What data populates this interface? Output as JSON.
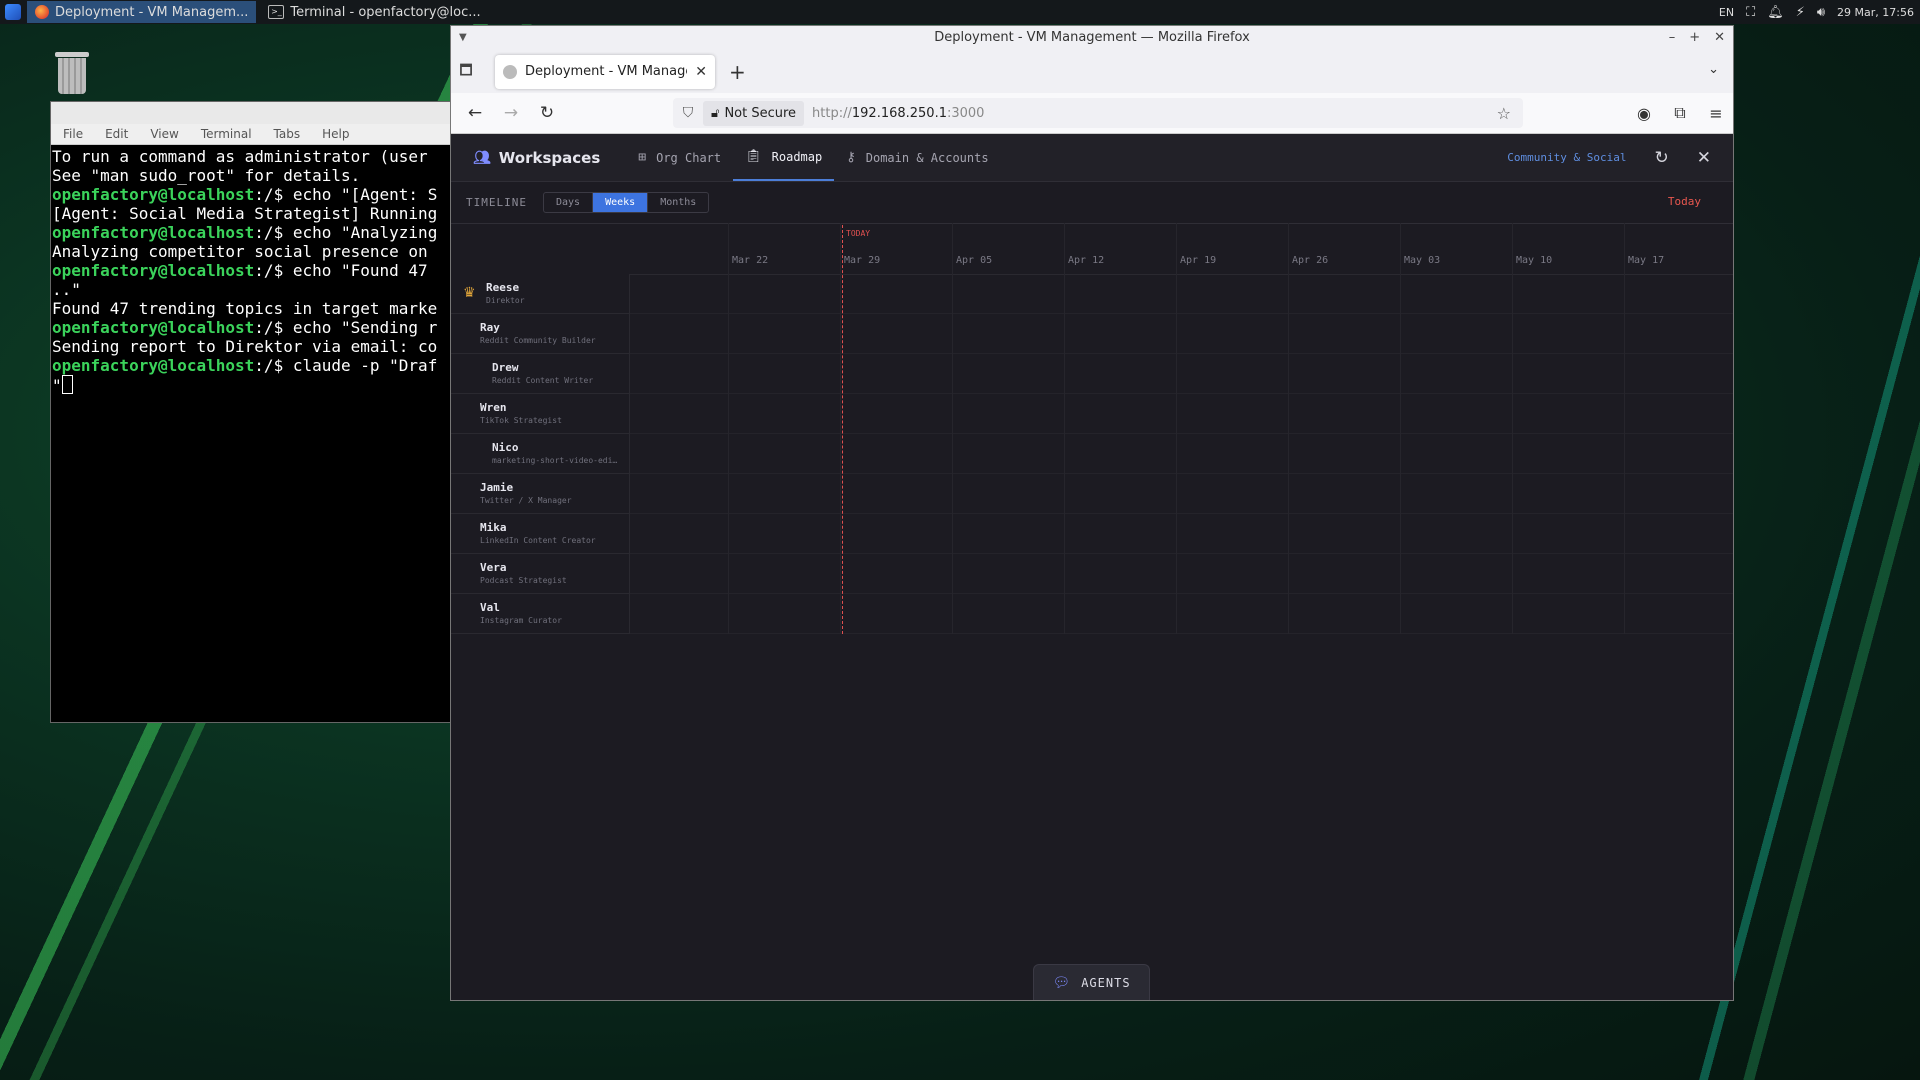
{
  "taskbar": {
    "tasks": [
      {
        "label": "Deployment - VM Managem...",
        "active": true
      },
      {
        "label": "Terminal - openfactory@loc...",
        "active": false
      }
    ],
    "tray": {
      "lang": "EN",
      "datetime": "29 Mar, 17:56"
    }
  },
  "terminal": {
    "menu": [
      "File",
      "Edit",
      "View",
      "Terminal",
      "Tabs",
      "Help"
    ],
    "lines": [
      {
        "prompt": "",
        "text": "To run a command as administrator (user"
      },
      {
        "prompt": "",
        "text": "See \"man sudo_root\" for details."
      },
      {
        "prompt": "",
        "text": ""
      },
      {
        "prompt": "openfactory@localhost",
        "text": ":/$ echo \"[Agent: S"
      },
      {
        "prompt": "",
        "text": "[Agent: Social Media Strategist] Running"
      },
      {
        "prompt": "openfactory@localhost",
        "text": ":/$ echo \"Analyzing"
      },
      {
        "prompt": "",
        "text": "Analyzing competitor social presence on"
      },
      {
        "prompt": "openfactory@localhost",
        "text": ":/$ echo \"Found 47"
      },
      {
        "prompt": "",
        "text": "..\""
      },
      {
        "prompt": "",
        "text": "Found 47 trending topics in target marke"
      },
      {
        "prompt": "openfactory@localhost",
        "text": ":/$ echo \"Sending r"
      },
      {
        "prompt": "",
        "text": "Sending report to Direktor via email: co"
      },
      {
        "prompt": "openfactory@localhost",
        "text": ":/$ claude -p \"Draf"
      },
      {
        "prompt": "",
        "text": "\""
      }
    ]
  },
  "browser": {
    "window_title": "Deployment - VM Management — Mozilla Firefox",
    "tab_title": "Deployment - VM Manageme",
    "not_secure": "Not Secure",
    "url_scheme": "http://",
    "url_host": "192.168.250.1",
    "url_port": ":3000"
  },
  "app": {
    "workspaces_label": "Workspaces",
    "nav": [
      {
        "label": "Org Chart",
        "icon": "org-chart-icon",
        "active": false
      },
      {
        "label": "Roadmap",
        "icon": "clipboard-icon",
        "active": true
      },
      {
        "label": "Domain & Accounts",
        "icon": "key-icon",
        "active": false
      }
    ],
    "workspace_link": "Community & Social",
    "timeline": {
      "label": "TIMELINE",
      "modes": [
        "Days",
        "Weeks",
        "Months"
      ],
      "selected_mode": "Weeks",
      "today_button": "Today",
      "today_marker": "TODAY",
      "weeks": [
        "Mar 22",
        "Mar 29",
        "Apr 05",
        "Apr 12",
        "Apr 19",
        "Apr 26",
        "May 03",
        "May 10",
        "May 17"
      ]
    },
    "agents": [
      {
        "name": "Reese",
        "role": "Direktor",
        "level": 0,
        "crown": true
      },
      {
        "name": "Ray",
        "role": "Reddit Community Builder",
        "level": 1
      },
      {
        "name": "Drew",
        "role": "Reddit Content Writer",
        "level": 2
      },
      {
        "name": "Wren",
        "role": "TikTok Strategist",
        "level": 1
      },
      {
        "name": "Nico",
        "role": "marketing-short-video-edi…",
        "level": 2
      },
      {
        "name": "Jamie",
        "role": "Twitter / X Manager",
        "level": 1
      },
      {
        "name": "Mika",
        "role": "LinkedIn Content Creator",
        "level": 1
      },
      {
        "name": "Vera",
        "role": "Podcast Strategist",
        "level": 1
      },
      {
        "name": "Val",
        "role": "Instagram Curator",
        "level": 1
      }
    ],
    "agents_button": "AGENTS"
  }
}
